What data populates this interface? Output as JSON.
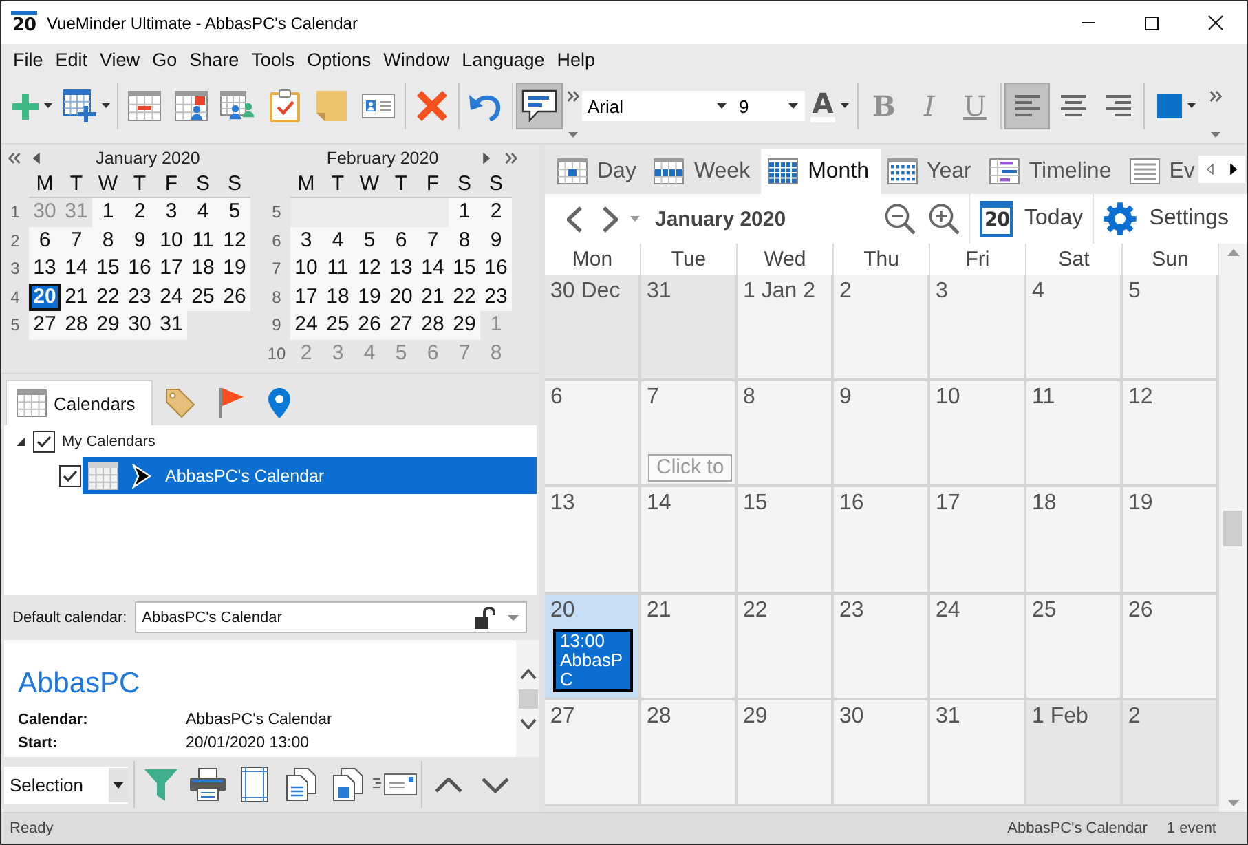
{
  "window": {
    "icon_label": "20",
    "title": "VueMinder Ultimate - AbbasPC's Calendar"
  },
  "menu": [
    "File",
    "Edit",
    "View",
    "Go",
    "Share",
    "Tools",
    "Options",
    "Window",
    "Language",
    "Help"
  ],
  "toolbar": {
    "groups": [
      {
        "items": [
          {
            "kind": "add",
            "dropdown": true,
            "pressed": false
          },
          {
            "kind": "new_calendar",
            "dropdown": true,
            "pressed": false
          }
        ]
      },
      {
        "items": [
          {
            "kind": "remove_calendar",
            "dropdown": false,
            "pressed": false
          },
          {
            "kind": "share_calendar",
            "dropdown": false,
            "pressed": false
          },
          {
            "kind": "people",
            "dropdown": false,
            "pressed": false
          },
          {
            "kind": "tasks",
            "dropdown": false,
            "pressed": false
          },
          {
            "kind": "note",
            "dropdown": false,
            "pressed": false
          },
          {
            "kind": "contact",
            "dropdown": false,
            "pressed": false
          }
        ]
      },
      {
        "items": [
          {
            "kind": "delete",
            "dropdown": false,
            "pressed": false
          }
        ]
      },
      {
        "items": [
          {
            "kind": "undo",
            "dropdown": false,
            "pressed": false
          }
        ]
      },
      {
        "items": [
          {
            "kind": "comment",
            "dropdown": false,
            "pressed": true
          }
        ]
      }
    ]
  },
  "format_toolbar": {
    "font": "Arial",
    "size": "9",
    "groups": [
      {
        "items": [
          {
            "kind": "font_color",
            "label": "A",
            "dropdown": true,
            "pressed": false,
            "disabled": false
          }
        ]
      },
      {
        "items": [
          {
            "kind": "bold",
            "label": "B",
            "dropdown": false,
            "pressed": false,
            "disabled": true
          },
          {
            "kind": "italic",
            "label": "I",
            "dropdown": false,
            "pressed": false,
            "disabled": true
          },
          {
            "kind": "underline",
            "label": "U",
            "dropdown": false,
            "pressed": false,
            "disabled": true
          }
        ]
      },
      {
        "items": [
          {
            "kind": "align_left",
            "dropdown": false,
            "pressed": true,
            "disabled": false
          },
          {
            "kind": "align_center",
            "dropdown": false,
            "pressed": false,
            "disabled": false
          },
          {
            "kind": "align_right",
            "dropdown": false,
            "pressed": false,
            "disabled": false
          }
        ]
      },
      {
        "items": [
          {
            "kind": "fill_color",
            "dropdown": true,
            "pressed": false,
            "disabled": false
          }
        ]
      }
    ]
  },
  "mini_calendars": [
    {
      "title": "January 2020",
      "weekdays": [
        "M",
        "T",
        "W",
        "T",
        "F",
        "S",
        "S"
      ],
      "weeks": [
        {
          "number": "1",
          "days": [
            {
              "kind": "day",
              "label": "30",
              "muted": true,
              "selected": false
            },
            {
              "kind": "day",
              "label": "31",
              "muted": true,
              "selected": false
            },
            {
              "kind": "day",
              "label": "1",
              "muted": false,
              "selected": false
            },
            {
              "kind": "day",
              "label": "2",
              "muted": false,
              "selected": false
            },
            {
              "kind": "day",
              "label": "3",
              "muted": false,
              "selected": false
            },
            {
              "kind": "day",
              "label": "4",
              "muted": false,
              "selected": false
            },
            {
              "kind": "day",
              "label": "5",
              "muted": false,
              "selected": false
            }
          ]
        },
        {
          "number": "2",
          "days": [
            {
              "kind": "day",
              "label": "6",
              "muted": false,
              "selected": false
            },
            {
              "kind": "day",
              "label": "7",
              "muted": false,
              "selected": false
            },
            {
              "kind": "day",
              "label": "8",
              "muted": false,
              "selected": false
            },
            {
              "kind": "day",
              "label": "9",
              "muted": false,
              "selected": false
            },
            {
              "kind": "day",
              "label": "10",
              "muted": false,
              "selected": false
            },
            {
              "kind": "day",
              "label": "11",
              "muted": false,
              "selected": false
            },
            {
              "kind": "day",
              "label": "12",
              "muted": false,
              "selected": false
            }
          ]
        },
        {
          "number": "3",
          "days": [
            {
              "kind": "day",
              "label": "13",
              "muted": false,
              "selected": false
            },
            {
              "kind": "day",
              "label": "14",
              "muted": false,
              "selected": false
            },
            {
              "kind": "day",
              "label": "15",
              "muted": false,
              "selected": false
            },
            {
              "kind": "day",
              "label": "16",
              "muted": false,
              "selected": false
            },
            {
              "kind": "day",
              "label": "17",
              "muted": false,
              "selected": false
            },
            {
              "kind": "day",
              "label": "18",
              "muted": false,
              "selected": false
            },
            {
              "kind": "day",
              "label": "19",
              "muted": false,
              "selected": false
            }
          ]
        },
        {
          "number": "4",
          "days": [
            {
              "kind": "day",
              "label": "20",
              "muted": false,
              "selected": true
            },
            {
              "kind": "day",
              "label": "21",
              "muted": false,
              "selected": false
            },
            {
              "kind": "day",
              "label": "22",
              "muted": false,
              "selected": false
            },
            {
              "kind": "day",
              "label": "23",
              "muted": false,
              "selected": false
            },
            {
              "kind": "day",
              "label": "24",
              "muted": false,
              "selected": false
            },
            {
              "kind": "day",
              "label": "25",
              "muted": false,
              "selected": false
            },
            {
              "kind": "day",
              "label": "26",
              "muted": false,
              "selected": false
            }
          ]
        },
        {
          "number": "5",
          "days": [
            {
              "kind": "day",
              "label": "27",
              "muted": false,
              "selected": false
            },
            {
              "kind": "day",
              "label": "28",
              "muted": false,
              "selected": false
            },
            {
              "kind": "day",
              "label": "29",
              "muted": false,
              "selected": false
            },
            {
              "kind": "day",
              "label": "30",
              "muted": false,
              "selected": false
            },
            {
              "kind": "day",
              "label": "31",
              "muted": false,
              "selected": false
            }
          ]
        }
      ]
    },
    {
      "title": "February 2020",
      "weekdays": [
        "M",
        "T",
        "W",
        "T",
        "F",
        "S",
        "S"
      ],
      "weeks": [
        {
          "number": "5",
          "days": [
            {
              "kind": "blank"
            },
            {
              "kind": "blank"
            },
            {
              "kind": "blank"
            },
            {
              "kind": "blank"
            },
            {
              "kind": "blank"
            },
            {
              "kind": "day",
              "label": "1",
              "muted": false,
              "selected": false
            },
            {
              "kind": "day",
              "label": "2",
              "muted": false,
              "selected": false
            }
          ]
        },
        {
          "number": "6",
          "days": [
            {
              "kind": "day",
              "label": "3",
              "muted": false,
              "selected": false
            },
            {
              "kind": "day",
              "label": "4",
              "muted": false,
              "selected": false
            },
            {
              "kind": "day",
              "label": "5",
              "muted": false,
              "selected": false
            },
            {
              "kind": "day",
              "label": "6",
              "muted": false,
              "selected": false
            },
            {
              "kind": "day",
              "label": "7",
              "muted": false,
              "selected": false
            },
            {
              "kind": "day",
              "label": "8",
              "muted": false,
              "selected": false
            },
            {
              "kind": "day",
              "label": "9",
              "muted": false,
              "selected": false
            }
          ]
        },
        {
          "number": "7",
          "days": [
            {
              "kind": "day",
              "label": "10",
              "muted": false,
              "selected": false
            },
            {
              "kind": "day",
              "label": "11",
              "muted": false,
              "selected": false
            },
            {
              "kind": "day",
              "label": "12",
              "muted": false,
              "selected": false
            },
            {
              "kind": "day",
              "label": "13",
              "muted": false,
              "selected": false
            },
            {
              "kind": "day",
              "label": "14",
              "muted": false,
              "selected": false
            },
            {
              "kind": "day",
              "label": "15",
              "muted": false,
              "selected": false
            },
            {
              "kind": "day",
              "label": "16",
              "muted": false,
              "selected": false
            }
          ]
        },
        {
          "number": "8",
          "days": [
            {
              "kind": "day",
              "label": "17",
              "muted": false,
              "selected": false
            },
            {
              "kind": "day",
              "label": "18",
              "muted": false,
              "selected": false
            },
            {
              "kind": "day",
              "label": "19",
              "muted": false,
              "selected": false
            },
            {
              "kind": "day",
              "label": "20",
              "muted": false,
              "selected": false
            },
            {
              "kind": "day",
              "label": "21",
              "muted": false,
              "selected": false
            },
            {
              "kind": "day",
              "label": "22",
              "muted": false,
              "selected": false
            },
            {
              "kind": "day",
              "label": "23",
              "muted": false,
              "selected": false
            }
          ]
        },
        {
          "number": "9",
          "days": [
            {
              "kind": "day",
              "label": "24",
              "muted": false,
              "selected": false
            },
            {
              "kind": "day",
              "label": "25",
              "muted": false,
              "selected": false
            },
            {
              "kind": "day",
              "label": "26",
              "muted": false,
              "selected": false
            },
            {
              "kind": "day",
              "label": "27",
              "muted": false,
              "selected": false
            },
            {
              "kind": "day",
              "label": "28",
              "muted": false,
              "selected": false
            },
            {
              "kind": "day",
              "label": "29",
              "muted": false,
              "selected": false
            },
            {
              "kind": "day",
              "label": "1",
              "muted": true,
              "selected": false
            }
          ]
        },
        {
          "number": "10",
          "days": [
            {
              "kind": "day",
              "label": "2",
              "muted": true,
              "selected": false
            },
            {
              "kind": "day",
              "label": "3",
              "muted": true,
              "selected": false
            },
            {
              "kind": "day",
              "label": "4",
              "muted": true,
              "selected": false
            },
            {
              "kind": "day",
              "label": "5",
              "muted": true,
              "selected": false
            },
            {
              "kind": "day",
              "label": "6",
              "muted": true,
              "selected": false
            },
            {
              "kind": "day",
              "label": "7",
              "muted": true,
              "selected": false
            },
            {
              "kind": "day",
              "label": "8",
              "muted": true,
              "selected": false
            }
          ]
        }
      ]
    }
  ],
  "side_tabs": [
    {
      "kind": "calendars",
      "label": "Calendars",
      "selected": true
    },
    {
      "kind": "tags",
      "selected": false
    },
    {
      "kind": "flags",
      "selected": false
    },
    {
      "kind": "locations",
      "selected": false
    }
  ],
  "calendar_tree": [
    {
      "label": "My Calendars",
      "checked": true,
      "expanded": true,
      "selected": false,
      "children": [
        {
          "label": "AbbasPC's Calendar",
          "checked": true,
          "selected": true
        }
      ]
    }
  ],
  "default_calendar": {
    "label": "Default calendar:",
    "value": "AbbasPC's Calendar",
    "locked": false
  },
  "details": {
    "title": "AbbasPC",
    "fields": [
      {
        "label": "Calendar:",
        "value": "AbbasPC's Calendar"
      },
      {
        "label": "Start:",
        "value": "20/01/2020 13:00"
      }
    ]
  },
  "bottom_toolbar": {
    "mode": "Selection",
    "buttons": [
      {
        "kind": "filter"
      },
      {
        "kind": "print"
      },
      {
        "kind": "page_setup"
      },
      {
        "kind": "copy"
      },
      {
        "kind": "copy_text"
      },
      {
        "kind": "email"
      }
    ],
    "nav": [
      {
        "kind": "up"
      },
      {
        "kind": "down"
      }
    ]
  },
  "view_tabs": [
    {
      "kind": "day",
      "label": "Day",
      "selected": false
    },
    {
      "kind": "week",
      "label": "Week",
      "selected": false
    },
    {
      "kind": "month",
      "label": "Month",
      "selected": true
    },
    {
      "kind": "year",
      "label": "Year",
      "selected": false
    },
    {
      "kind": "timeline",
      "label": "Timeline",
      "selected": false
    },
    {
      "kind": "events",
      "label": "Ev",
      "selected": false
    }
  ],
  "nav": {
    "period": "January 2020",
    "today_icon_label": "20",
    "today": "Today",
    "settings": "Settings"
  },
  "month": {
    "day_names": [
      "Mon",
      "Tue",
      "Wed",
      "Thu",
      "Fri",
      "Sat",
      "Sun"
    ],
    "weeks": [
      {
        "days": [
          {
            "label": "30 Dec",
            "muted": true,
            "today": false
          },
          {
            "label": "31",
            "muted": true,
            "today": false
          },
          {
            "label": "1 Jan 2",
            "muted": false,
            "today": false
          },
          {
            "label": "2",
            "muted": false,
            "today": false
          },
          {
            "label": "3",
            "muted": false,
            "today": false
          },
          {
            "label": "4",
            "muted": false,
            "today": false
          },
          {
            "label": "5",
            "muted": false,
            "today": false
          }
        ]
      },
      {
        "days": [
          {
            "label": "6",
            "muted": false,
            "today": false
          },
          {
            "label": "7",
            "muted": false,
            "today": false,
            "hint": "Click to"
          },
          {
            "label": "8",
            "muted": false,
            "today": false
          },
          {
            "label": "9",
            "muted": false,
            "today": false
          },
          {
            "label": "10",
            "muted": false,
            "today": false
          },
          {
            "label": "11",
            "muted": false,
            "today": false
          },
          {
            "label": "12",
            "muted": false,
            "today": false
          }
        ]
      },
      {
        "days": [
          {
            "label": "13",
            "muted": false,
            "today": false
          },
          {
            "label": "14",
            "muted": false,
            "today": false
          },
          {
            "label": "15",
            "muted": false,
            "today": false
          },
          {
            "label": "16",
            "muted": false,
            "today": false
          },
          {
            "label": "17",
            "muted": false,
            "today": false
          },
          {
            "label": "18",
            "muted": false,
            "today": false
          },
          {
            "label": "19",
            "muted": false,
            "today": false
          }
        ]
      },
      {
        "days": [
          {
            "label": "20",
            "muted": false,
            "today": true,
            "events": [
              {
                "time": "13:00",
                "title": "AbbasPC",
                "selected": true
              }
            ]
          },
          {
            "label": "21",
            "muted": false,
            "today": false
          },
          {
            "label": "22",
            "muted": false,
            "today": false
          },
          {
            "label": "23",
            "muted": false,
            "today": false
          },
          {
            "label": "24",
            "muted": false,
            "today": false
          },
          {
            "label": "25",
            "muted": false,
            "today": false
          },
          {
            "label": "26",
            "muted": false,
            "today": false
          }
        ]
      },
      {
        "days": [
          {
            "label": "27",
            "muted": false,
            "today": false
          },
          {
            "label": "28",
            "muted": false,
            "today": false
          },
          {
            "label": "29",
            "muted": false,
            "today": false
          },
          {
            "label": "30",
            "muted": false,
            "today": false
          },
          {
            "label": "31",
            "muted": false,
            "today": false
          },
          {
            "label": "1 Feb",
            "muted": true,
            "today": false
          },
          {
            "label": "2",
            "muted": true,
            "today": false
          }
        ]
      }
    ]
  },
  "status_bar": {
    "message": "Ready",
    "calendar": "AbbasPC's Calendar",
    "count": "1 event"
  }
}
